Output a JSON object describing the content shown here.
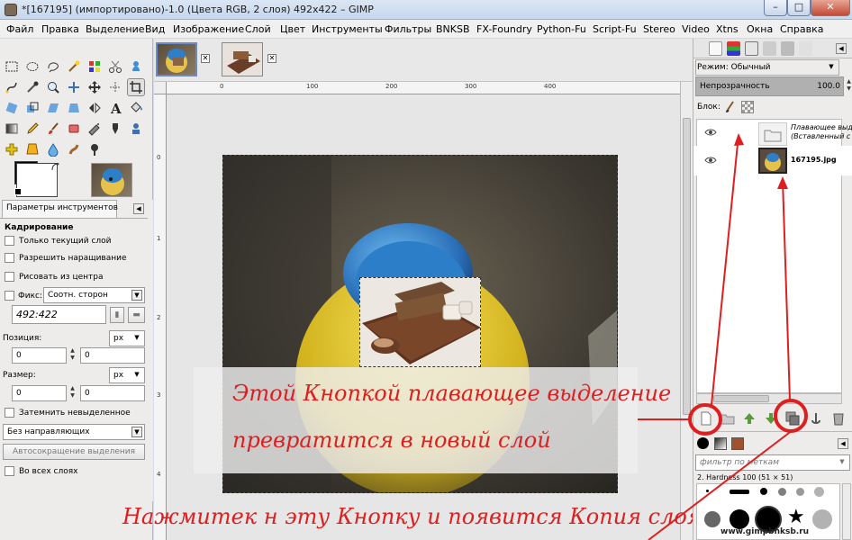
{
  "window": {
    "title": "*[167195] (импортировано)-1.0 (Цвета RGB, 2 слоя) 492x422 – GIMP",
    "minimize": "–",
    "maximize": "□",
    "close": "✕"
  },
  "menu": [
    "Файл",
    "Правка",
    "Выделение",
    "Вид",
    "Изображение",
    "Слой",
    "Цвет",
    "Инструменты",
    "Фильтры",
    "BNKSB",
    "FX-Foundry",
    "Python-Fu",
    "Script-Fu",
    "Stereo",
    "Video",
    "Xtns",
    "Окна",
    "Справка"
  ],
  "tool_options": {
    "tab_label": "Параметры инструментов",
    "tool_name": "Кадрирование",
    "only_current_layer": "Только текущий слой",
    "allow_growing": "Разрешить наращивание",
    "draw_from_center": "Рисовать из центра",
    "fixed_label": "Фикс:",
    "fixed_value": "Соотн. сторон",
    "ratio_value": "492:422",
    "position_label": "Позиция:",
    "position_unit": "px",
    "position_x": "0",
    "position_y": "0",
    "size_label": "Размер:",
    "size_unit": "px",
    "size_w": "0",
    "size_h": "0",
    "darken_unselected": "Затемнить невыделенное",
    "guides_value": "Без направляющих",
    "auto_shrink": "Автосокращение выделения",
    "all_layers": "Во всех слоях"
  },
  "rulers": {
    "top": [
      "0",
      "100",
      "200",
      "300",
      "400"
    ],
    "left": [
      "0",
      "1",
      "2",
      "3",
      "4"
    ]
  },
  "layers": {
    "mode_label": "Режим:",
    "mode_value": "Обычный",
    "opacity_label": "Непрозрачность",
    "opacity_value": "100.0",
    "opacity_fraction": 1.0,
    "lock_label": "Блок:",
    "items": [
      {
        "name": "Плавающее выд",
        "subname": "(Вставленный с"
      },
      {
        "name": "167195.jpg",
        "subname": ""
      }
    ]
  },
  "brushes": {
    "filter_placeholder": "фильтр по меткам",
    "brush_name": "2. Hardness 100 (51 × 51)"
  },
  "annotations": {
    "line1": "Этой Кнопкой плавающее выделение",
    "line2": "превратится в новый слой",
    "line3": "Нажмитек н эту Кнопку и появится Копия слоя"
  },
  "watermark": "www.gimpbnksb.ru",
  "colors": {
    "annotation_red": "#dd1f1f",
    "title_bar": "#c6d6ec",
    "close_button": "#c24b35"
  },
  "icons": {
    "new_layer": "new-layer-icon",
    "anchor": "anchor-icon",
    "duplicate": "duplicate-layer-icon",
    "trash": "trash-icon",
    "eye": "eye-icon"
  }
}
